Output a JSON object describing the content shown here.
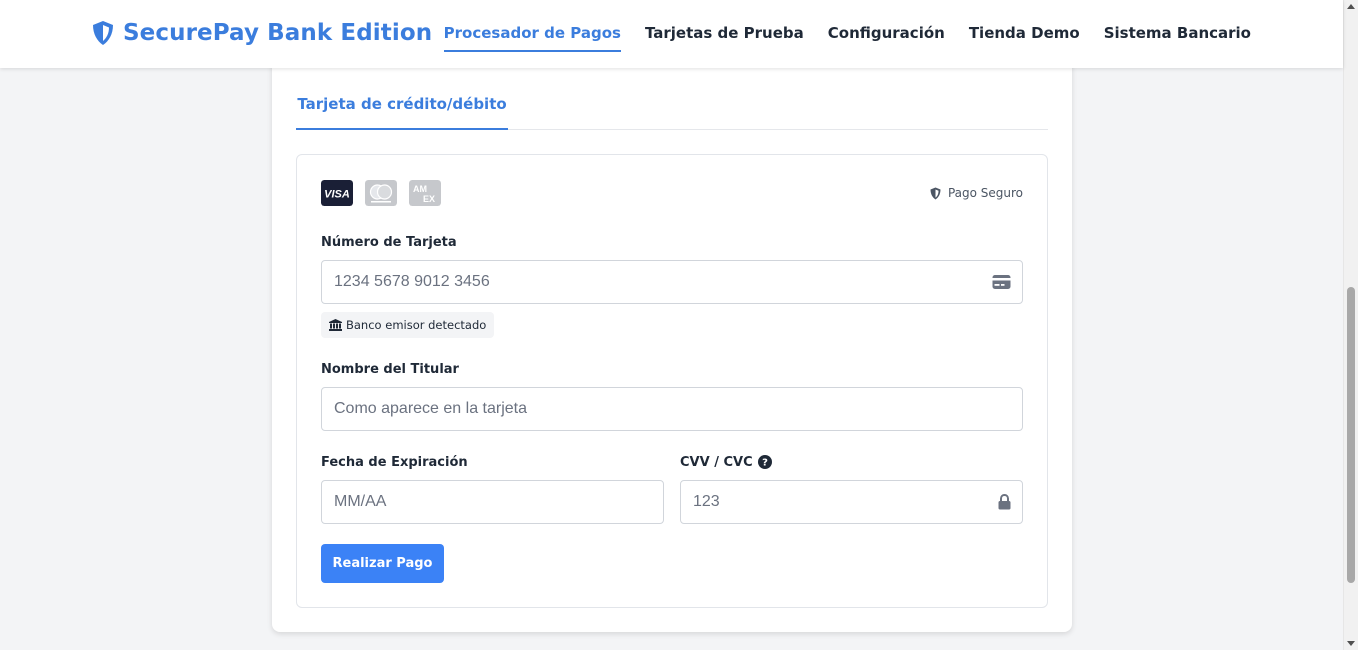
{
  "header": {
    "brand_icon": "shield-icon",
    "brand_name": "SecurePay Bank Edition",
    "nav": [
      {
        "label": "Procesador de Pagos",
        "active": true
      },
      {
        "label": "Tarjetas de Prueba"
      },
      {
        "label": "Configuración"
      },
      {
        "label": "Tienda Demo"
      },
      {
        "label": "Sistema Bancario"
      }
    ]
  },
  "tabs": [
    {
      "label": "Tarjeta de crédito/débito",
      "active": true
    }
  ],
  "form": {
    "card_brands": [
      "visa-icon",
      "mastercard-icon",
      "amex-icon"
    ],
    "secure_label": "Pago Seguro",
    "card_number": {
      "label": "Número de Tarjeta",
      "placeholder": "1234 5678 9012 3456",
      "icon": "credit-card-icon"
    },
    "bank_badge": "Banco emisor detectado",
    "holder": {
      "label": "Nombre del Titular",
      "placeholder": "Como aparece en la tarjeta"
    },
    "expiry": {
      "label": "Fecha de Expiración",
      "placeholder": "MM/AA"
    },
    "cvv": {
      "label": "CVV / CVC",
      "placeholder": "123",
      "icon": "lock-icon",
      "help_icon": "question-circle-icon"
    },
    "submit_label": "Realizar Pago"
  },
  "colors": {
    "accent": "#3b7ddd",
    "button": "#3b82f6",
    "background": "#f3f4f6"
  }
}
